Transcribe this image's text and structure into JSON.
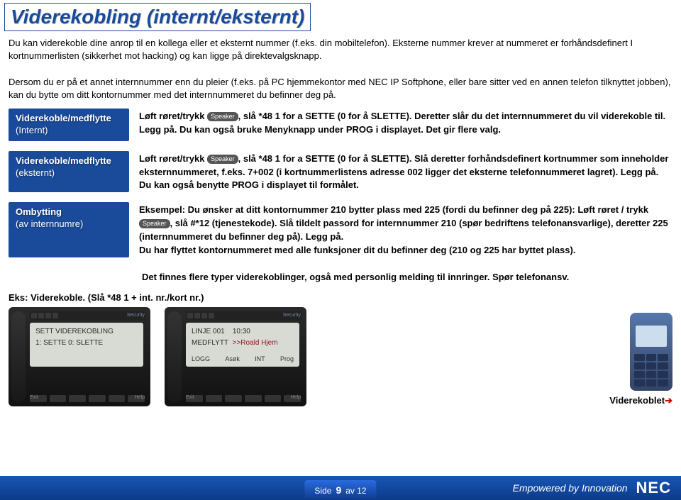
{
  "title": "Viderekobling (internt/eksternt)",
  "intro": {
    "p1": "Du kan viderekoble dine anrop til en kollega eller et eksternt nummer (f.eks. din mobiltelefon). Eksterne nummer krever at nummeret er forhåndsdefinert I kortnummerlisten (sikkerhet mot hacking) og kan ligge på direktevalgsknapp.",
    "p2": "Dersom du er på et annet internnummer enn du pleier (f.eks. på PC hjemmekontor med NEC IP Softphone, eller bare sitter ved en annen telefon tilknyttet jobben), kan du bytte om ditt kontornummer med det internnummeret du befinner deg på."
  },
  "speaker_key": "Speaker",
  "sections": [
    {
      "label_main": "Viderekoble/medflytte",
      "label_sub": "(Internt)",
      "body_pre": "Løft røret/trykk ",
      "body_post": ", slå *48 1 for a SETTE (0 for å SLETTE). Deretter slår du det internnummeret du vil viderekoble til. Legg på. Du kan også bruke Menyknapp under PROG i displayet. Det gir flere valg."
    },
    {
      "label_main": "Viderekoble/medflytte",
      "label_sub": "(eksternt)",
      "body_pre": "Løft røret/trykk ",
      "body_post": ", slå *48 1 for a SETTE (0 for å SLETTE). Slå deretter forhåndsdefinert kortnummer som inneholder eksternnummeret, f.eks. 7+002 (i kortnummerlistens adresse 002 ligger det eksterne telefonnummeret lagret). Legg på. Du kan også benytte PROG i displayet til formålet."
    },
    {
      "label_main": "Ombytting",
      "label_sub": "(av internnumre)",
      "body_pre": "Eksempel: Du ønsker at ditt kontornummer 210 bytter plass med 225 (fordi du befinner deg på 225): Løft røret / trykk ",
      "body_post": ", slå #*12 (tjenestekode). Slå tildelt passord for internnummer 210 (spør bedriftens telefonansvarlige), deretter 225 (internnummeret du befinner deg på). Legg på.",
      "body_extra": "Du har flyttet kontornummeret med alle funksjoner dit du befinner deg (210 og 225 har byttet plass)."
    }
  ],
  "note": "Det finnes flere typer viderekoblinger, også med personlig melding til innringer. Spør telefonansv.",
  "example_head": "Eks: Viderekoble. (Slå *48 1 + int. nr./kort nr.)",
  "phone1": {
    "security": "Security",
    "line1": "SETT VIDEREKOBLING",
    "line2": "1: SETTE   0: SLETTE",
    "menu": [
      "",
      "",
      "",
      ""
    ]
  },
  "phone2": {
    "security": "Security",
    "l1a": "LINJE 001",
    "l1b": "10:30",
    "l2a": "MEDFLYTT",
    "l2b": ">>Roald Hjem",
    "menu": [
      "LOGG",
      "Asøk",
      "INT",
      "Prog"
    ]
  },
  "key_labels": {
    "exit": "Exit",
    "help": "Help"
  },
  "mobile_label": "Viderekoblet",
  "footer": {
    "side": "Side",
    "page": "9",
    "av": "av 12",
    "tagline": "Empowered by Innovation",
    "logo": "NEC"
  }
}
